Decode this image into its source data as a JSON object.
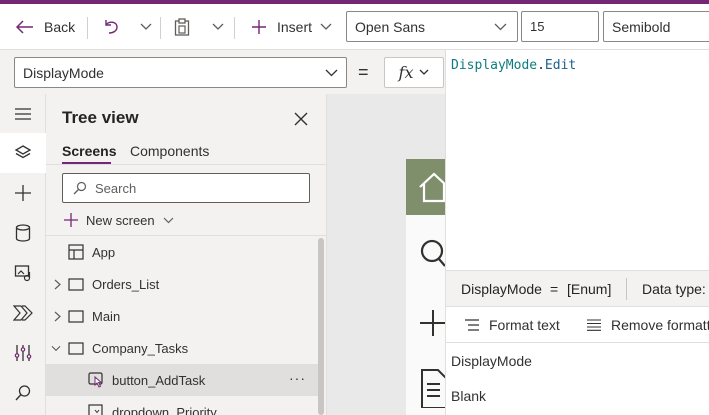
{
  "toolbar": {
    "back_label": "Back",
    "insert_label": "Insert",
    "font_family": "Open Sans",
    "font_size": "15",
    "font_weight": "Semibold"
  },
  "formula_bar": {
    "property": "DisplayMode",
    "equals": "=",
    "fx_label": "fx",
    "formula_object": "DisplayMode",
    "formula_dot": ".",
    "formula_member": "Edit"
  },
  "tree_view": {
    "title": "Tree view",
    "tabs": [
      {
        "label": "Screens",
        "active": true
      },
      {
        "label": "Components",
        "active": false
      }
    ],
    "search_placeholder": "Search",
    "new_screen_label": "New screen",
    "items": [
      {
        "label": "App",
        "icon": "app-icon"
      },
      {
        "label": "Orders_List",
        "icon": "screen-icon"
      },
      {
        "label": "Main",
        "icon": "screen-icon"
      },
      {
        "label": "Company_Tasks",
        "icon": "screen-icon"
      },
      {
        "label": "button_AddTask",
        "icon": "button-control-icon"
      },
      {
        "label": "dropdown_Priority",
        "icon": "dropdown-control-icon"
      }
    ],
    "more_label": "···"
  },
  "editor": {
    "info_property": "DisplayMode",
    "info_equals": "=",
    "info_type": "[Enum]",
    "data_type_label": "Data type: l",
    "format_text_label": "Format text",
    "remove_formatting_label": "Remove formatti",
    "suggestions": [
      "DisplayMode",
      "Blank"
    ]
  },
  "colors": {
    "accent": "#742774",
    "app_header": "#7f8f6c",
    "formula_object": "#0f7c7e",
    "formula_member": "#1c5f8e"
  }
}
